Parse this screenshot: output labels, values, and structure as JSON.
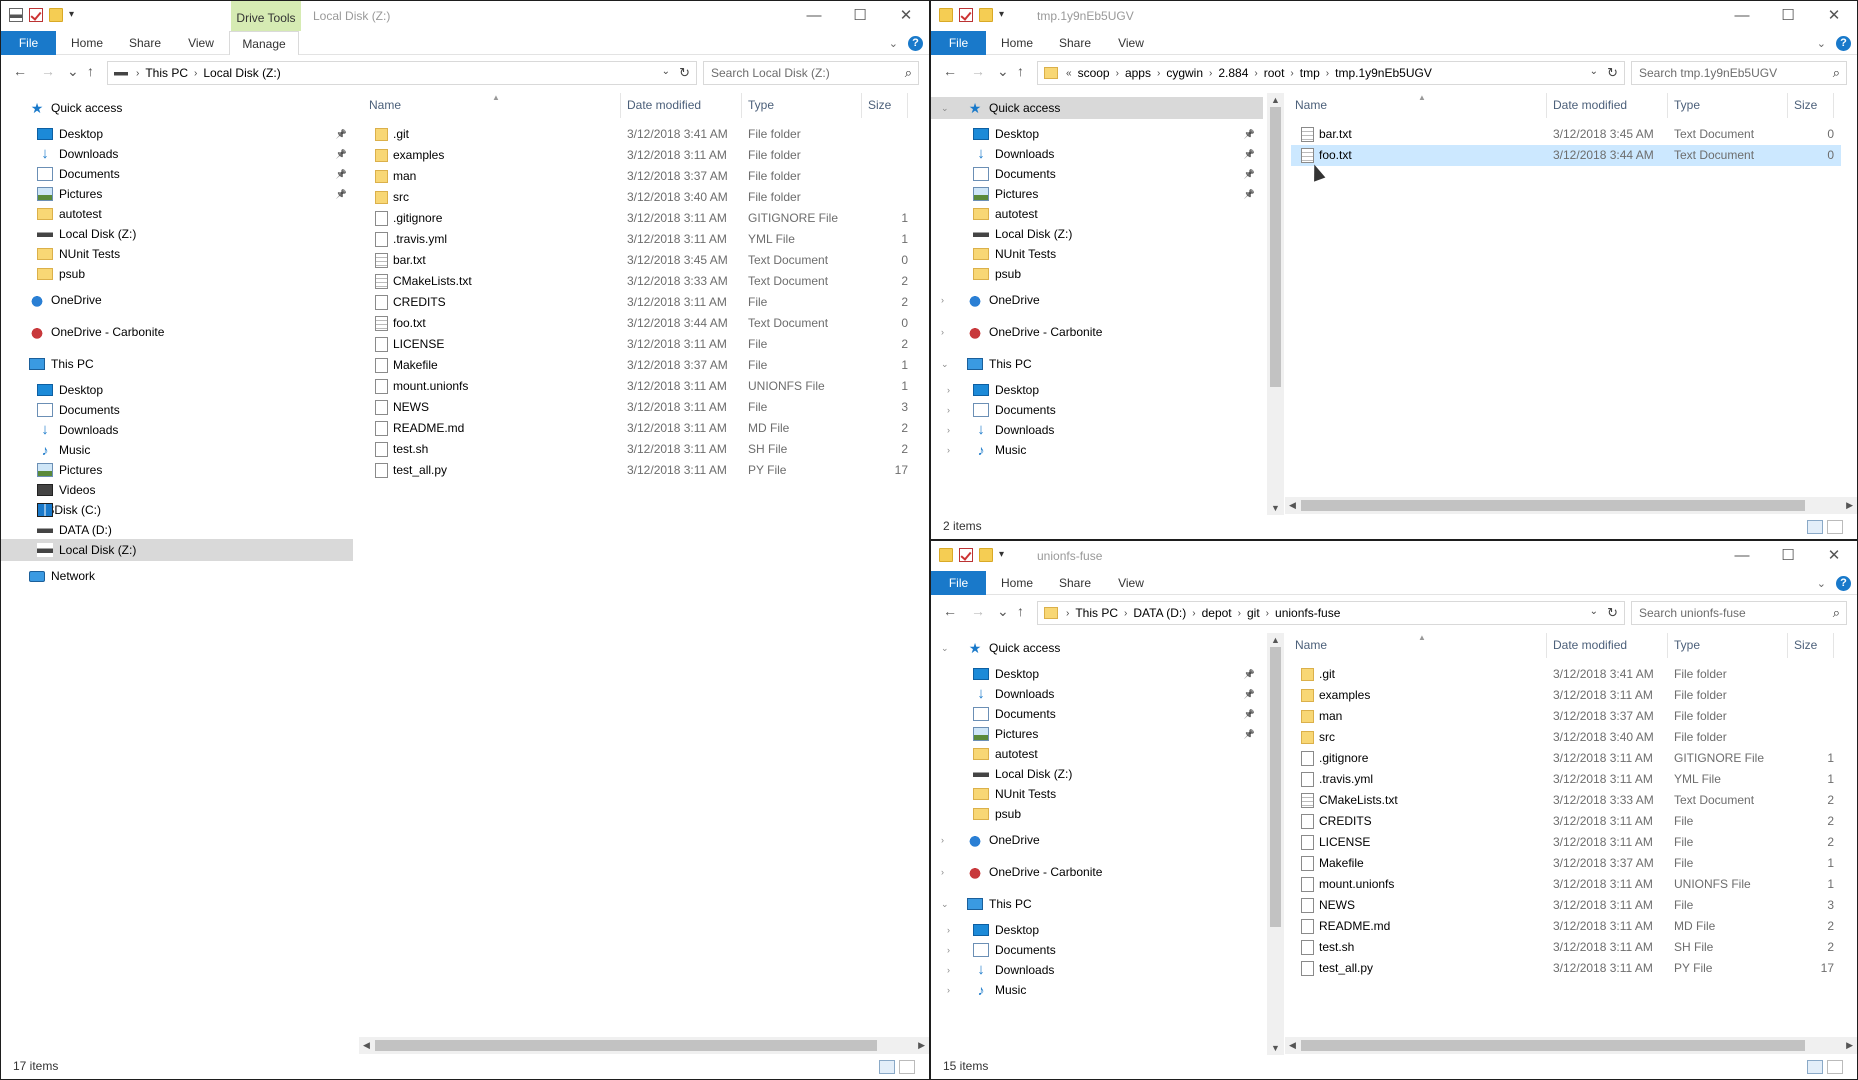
{
  "win1": {
    "title": "Local Disk (Z:)",
    "context_tab": "Drive Tools",
    "tabs": [
      "File",
      "Home",
      "Share",
      "View",
      "Manage"
    ],
    "address": [
      "This PC",
      "Local Disk (Z:)"
    ],
    "search_placeholder": "Search Local Disk (Z:)",
    "status": "17 items",
    "nav": [
      {
        "label": "Quick access",
        "icon": "star-icon"
      },
      {
        "label": "Desktop",
        "icon": "desktop-icon",
        "pinned": true
      },
      {
        "label": "Downloads",
        "icon": "download-icon",
        "pinned": true
      },
      {
        "label": "Documents",
        "icon": "documents-icon",
        "pinned": true
      },
      {
        "label": "Pictures",
        "icon": "pictures-icon",
        "pinned": true
      },
      {
        "label": "autotest",
        "icon": "folder-icon"
      },
      {
        "label": "Local Disk (Z:)",
        "icon": "drive-icon"
      },
      {
        "label": "NUnit Tests",
        "icon": "folder-icon"
      },
      {
        "label": "psub",
        "icon": "folder-icon"
      },
      {
        "label": "OneDrive",
        "icon": "onedrive-icon"
      },
      {
        "label": "OneDrive - Carbonite",
        "icon": "onedrive-carbonite-icon"
      },
      {
        "label": "This PC",
        "icon": "this-pc-icon"
      },
      {
        "label": "Desktop",
        "icon": "desktop-icon"
      },
      {
        "label": "Documents",
        "icon": "documents-icon"
      },
      {
        "label": "Downloads",
        "icon": "download-icon"
      },
      {
        "label": "Music",
        "icon": "music-icon"
      },
      {
        "label": "Pictures",
        "icon": "pictures-icon"
      },
      {
        "label": "Videos",
        "icon": "videos-icon"
      },
      {
        "label": "OSDisk (C:)",
        "icon": "windows-drive-icon"
      },
      {
        "label": "DATA (D:)",
        "icon": "drive-icon"
      },
      {
        "label": "Local Disk (Z:)",
        "icon": "drive-icon",
        "selected": true
      },
      {
        "label": "Network",
        "icon": "network-icon"
      }
    ],
    "columns": [
      "Name",
      "Date modified",
      "Type",
      "Size"
    ],
    "files": [
      {
        "name": ".git",
        "date": "3/12/2018 3:41 AM",
        "type": "File folder",
        "size": "",
        "kind": "folder"
      },
      {
        "name": "examples",
        "date": "3/12/2018 3:11 AM",
        "type": "File folder",
        "size": "",
        "kind": "folder"
      },
      {
        "name": "man",
        "date": "3/12/2018 3:37 AM",
        "type": "File folder",
        "size": "",
        "kind": "folder"
      },
      {
        "name": "src",
        "date": "3/12/2018 3:40 AM",
        "type": "File folder",
        "size": "",
        "kind": "folder"
      },
      {
        "name": ".gitignore",
        "date": "3/12/2018 3:11 AM",
        "type": "GITIGNORE File",
        "size": "1",
        "kind": "file"
      },
      {
        "name": ".travis.yml",
        "date": "3/12/2018 3:11 AM",
        "type": "YML File",
        "size": "1",
        "kind": "file"
      },
      {
        "name": "bar.txt",
        "date": "3/12/2018 3:45 AM",
        "type": "Text Document",
        "size": "0",
        "kind": "txt"
      },
      {
        "name": "CMakeLists.txt",
        "date": "3/12/2018 3:33 AM",
        "type": "Text Document",
        "size": "2",
        "kind": "txt"
      },
      {
        "name": "CREDITS",
        "date": "3/12/2018 3:11 AM",
        "type": "File",
        "size": "2",
        "kind": "file"
      },
      {
        "name": "foo.txt",
        "date": "3/12/2018 3:44 AM",
        "type": "Text Document",
        "size": "0",
        "kind": "txt"
      },
      {
        "name": "LICENSE",
        "date": "3/12/2018 3:11 AM",
        "type": "File",
        "size": "2",
        "kind": "file"
      },
      {
        "name": "Makefile",
        "date": "3/12/2018 3:37 AM",
        "type": "File",
        "size": "1",
        "kind": "file"
      },
      {
        "name": "mount.unionfs",
        "date": "3/12/2018 3:11 AM",
        "type": "UNIONFS File",
        "size": "1",
        "kind": "file"
      },
      {
        "name": "NEWS",
        "date": "3/12/2018 3:11 AM",
        "type": "File",
        "size": "3",
        "kind": "file"
      },
      {
        "name": "README.md",
        "date": "3/12/2018 3:11 AM",
        "type": "MD File",
        "size": "2",
        "kind": "file"
      },
      {
        "name": "test.sh",
        "date": "3/12/2018 3:11 AM",
        "type": "SH File",
        "size": "2",
        "kind": "file"
      },
      {
        "name": "test_all.py",
        "date": "3/12/2018 3:11 AM",
        "type": "PY File",
        "size": "17",
        "kind": "file"
      }
    ]
  },
  "win2": {
    "title": "tmp.1y9nEb5UGV",
    "tabs": [
      "File",
      "Home",
      "Share",
      "View"
    ],
    "address_prefix": "«",
    "address": [
      "scoop",
      "apps",
      "cygwin",
      "2.884",
      "root",
      "tmp",
      "tmp.1y9nEb5UGV"
    ],
    "search_placeholder": "Search tmp.1y9nEb5UGV",
    "status": "2 items",
    "nav": [
      {
        "label": "Quick access",
        "icon": "star-icon",
        "expander": "open",
        "highlight": true
      },
      {
        "label": "Desktop",
        "icon": "desktop-icon",
        "pinned": true
      },
      {
        "label": "Downloads",
        "icon": "download-icon",
        "pinned": true
      },
      {
        "label": "Documents",
        "icon": "documents-icon",
        "pinned": true
      },
      {
        "label": "Pictures",
        "icon": "pictures-icon",
        "pinned": true
      },
      {
        "label": "autotest",
        "icon": "folder-icon"
      },
      {
        "label": "Local Disk (Z:)",
        "icon": "drive-icon"
      },
      {
        "label": "NUnit Tests",
        "icon": "folder-icon"
      },
      {
        "label": "psub",
        "icon": "folder-icon"
      },
      {
        "label": "OneDrive",
        "icon": "onedrive-icon",
        "expander": "closed"
      },
      {
        "label": "OneDrive - Carbonite",
        "icon": "onedrive-carbonite-icon",
        "expander": "closed"
      },
      {
        "label": "This PC",
        "icon": "this-pc-icon",
        "expander": "open"
      },
      {
        "label": "Desktop",
        "icon": "desktop-icon",
        "expander": "closed"
      },
      {
        "label": "Documents",
        "icon": "documents-icon",
        "expander": "closed"
      },
      {
        "label": "Downloads",
        "icon": "download-icon",
        "expander": "closed"
      },
      {
        "label": "Music",
        "icon": "music-icon",
        "expander": "closed"
      }
    ],
    "columns": [
      "Name",
      "Date modified",
      "Type",
      "Size"
    ],
    "files": [
      {
        "name": "bar.txt",
        "date": "3/12/2018 3:45 AM",
        "type": "Text Document",
        "size": "0",
        "kind": "txt"
      },
      {
        "name": "foo.txt",
        "date": "3/12/2018 3:44 AM",
        "type": "Text Document",
        "size": "0",
        "kind": "txt",
        "selected": true
      }
    ]
  },
  "win3": {
    "title": "unionfs-fuse",
    "tabs": [
      "File",
      "Home",
      "Share",
      "View"
    ],
    "address": [
      "This PC",
      "DATA (D:)",
      "depot",
      "git",
      "unionfs-fuse"
    ],
    "search_placeholder": "Search unionfs-fuse",
    "status": "15 items",
    "nav": [
      {
        "label": "Quick access",
        "icon": "star-icon",
        "expander": "open"
      },
      {
        "label": "Desktop",
        "icon": "desktop-icon",
        "pinned": true
      },
      {
        "label": "Downloads",
        "icon": "download-icon",
        "pinned": true
      },
      {
        "label": "Documents",
        "icon": "documents-icon",
        "pinned": true
      },
      {
        "label": "Pictures",
        "icon": "pictures-icon",
        "pinned": true
      },
      {
        "label": "autotest",
        "icon": "folder-icon"
      },
      {
        "label": "Local Disk (Z:)",
        "icon": "drive-icon"
      },
      {
        "label": "NUnit Tests",
        "icon": "folder-icon"
      },
      {
        "label": "psub",
        "icon": "folder-icon"
      },
      {
        "label": "OneDrive",
        "icon": "onedrive-icon",
        "expander": "closed"
      },
      {
        "label": "OneDrive - Carbonite",
        "icon": "onedrive-carbonite-icon",
        "expander": "closed"
      },
      {
        "label": "This PC",
        "icon": "this-pc-icon",
        "expander": "open"
      },
      {
        "label": "Desktop",
        "icon": "desktop-icon",
        "expander": "closed"
      },
      {
        "label": "Documents",
        "icon": "documents-icon",
        "expander": "closed"
      },
      {
        "label": "Downloads",
        "icon": "download-icon",
        "expander": "closed"
      },
      {
        "label": "Music",
        "icon": "music-icon",
        "expander": "closed"
      }
    ],
    "columns": [
      "Name",
      "Date modified",
      "Type",
      "Size"
    ],
    "files": [
      {
        "name": ".git",
        "date": "3/12/2018 3:41 AM",
        "type": "File folder",
        "size": "",
        "kind": "folder"
      },
      {
        "name": "examples",
        "date": "3/12/2018 3:11 AM",
        "type": "File folder",
        "size": "",
        "kind": "folder"
      },
      {
        "name": "man",
        "date": "3/12/2018 3:37 AM",
        "type": "File folder",
        "size": "",
        "kind": "folder"
      },
      {
        "name": "src",
        "date": "3/12/2018 3:40 AM",
        "type": "File folder",
        "size": "",
        "kind": "folder"
      },
      {
        "name": ".gitignore",
        "date": "3/12/2018 3:11 AM",
        "type": "GITIGNORE File",
        "size": "1",
        "kind": "file"
      },
      {
        "name": ".travis.yml",
        "date": "3/12/2018 3:11 AM",
        "type": "YML File",
        "size": "1",
        "kind": "file"
      },
      {
        "name": "CMakeLists.txt",
        "date": "3/12/2018 3:33 AM",
        "type": "Text Document",
        "size": "2",
        "kind": "txt"
      },
      {
        "name": "CREDITS",
        "date": "3/12/2018 3:11 AM",
        "type": "File",
        "size": "2",
        "kind": "file"
      },
      {
        "name": "LICENSE",
        "date": "3/12/2018 3:11 AM",
        "type": "File",
        "size": "2",
        "kind": "file"
      },
      {
        "name": "Makefile",
        "date": "3/12/2018 3:37 AM",
        "type": "File",
        "size": "1",
        "kind": "file"
      },
      {
        "name": "mount.unionfs",
        "date": "3/12/2018 3:11 AM",
        "type": "UNIONFS File",
        "size": "1",
        "kind": "file"
      },
      {
        "name": "NEWS",
        "date": "3/12/2018 3:11 AM",
        "type": "File",
        "size": "3",
        "kind": "file"
      },
      {
        "name": "README.md",
        "date": "3/12/2018 3:11 AM",
        "type": "MD File",
        "size": "2",
        "kind": "file"
      },
      {
        "name": "test.sh",
        "date": "3/12/2018 3:11 AM",
        "type": "SH File",
        "size": "2",
        "kind": "file"
      },
      {
        "name": "test_all.py",
        "date": "3/12/2018 3:11 AM",
        "type": "PY File",
        "size": "17",
        "kind": "file"
      }
    ]
  },
  "colors": {
    "accent": "#1979ca",
    "selection": "#cce8ff",
    "drive_tools": "#d6ebb3"
  }
}
